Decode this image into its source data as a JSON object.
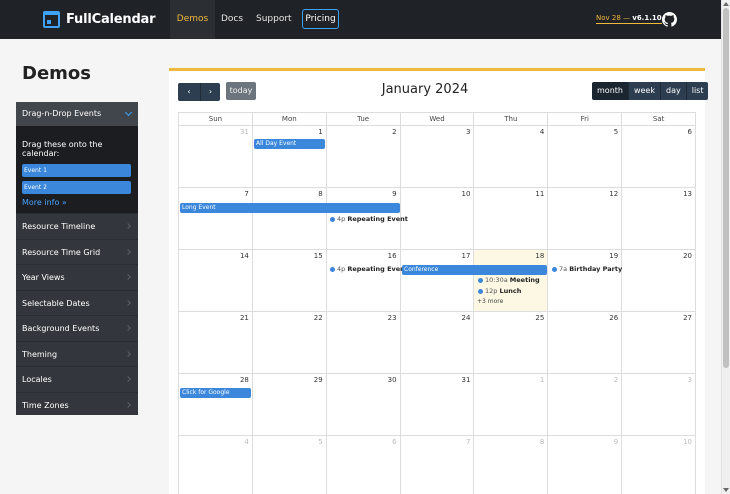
{
  "nav": {
    "logo": "FullCalendar",
    "items": [
      "Demos",
      "Docs",
      "Support"
    ],
    "pricing": "Pricing",
    "version_date": "Nov 28",
    "version_sep": " — ",
    "version_num": "v6.1.10"
  },
  "sidebar": {
    "title": "Demos",
    "active_item": "Drag-n-Drop Events",
    "drag_title": "Drag these onto the calendar:",
    "drag_events": [
      "Event 1",
      "Event 2"
    ],
    "more_info": "More info »",
    "items": [
      "Resource Timeline",
      "Resource Time Grid",
      "Year Views",
      "Selectable Dates",
      "Background Events",
      "Theming",
      "Locales",
      "Time Zones"
    ]
  },
  "toolbar": {
    "prev_icon": "‹",
    "next_icon": "›",
    "today": "today",
    "title": "January 2024",
    "views": [
      "month",
      "week",
      "day",
      "list"
    ]
  },
  "days_of_week": [
    "Sun",
    "Mon",
    "Tue",
    "Wed",
    "Thu",
    "Fri",
    "Sat"
  ],
  "weeks": [
    [
      31,
      1,
      2,
      3,
      4,
      5,
      6
    ],
    [
      7,
      8,
      9,
      10,
      11,
      12,
      13
    ],
    [
      14,
      15,
      16,
      17,
      18,
      19,
      20
    ],
    [
      21,
      22,
      23,
      24,
      25,
      26,
      27
    ],
    [
      28,
      29,
      30,
      31,
      1,
      2,
      3
    ],
    [
      4,
      5,
      6,
      7,
      8,
      9,
      10
    ]
  ],
  "events": {
    "all_day": "All Day Event",
    "long": "Long Event",
    "repeat1_time": "4p",
    "repeat1_title": "Repeating Event",
    "repeat2_time": "4p",
    "repeat2_title": "Repeating Event",
    "conference": "Conference",
    "meeting_time": "10:30a",
    "meeting_title": "Meeting",
    "lunch_time": "12p",
    "lunch_title": "Lunch",
    "more": "+3 more",
    "birthday_time": "7a",
    "birthday_title": "Birthday Party",
    "google": "Click for Google"
  },
  "colors": {
    "event": "#3a87db",
    "today_bg": "#fcf8e3",
    "accent": "#f0b83c",
    "nav_bg": "#1f2226"
  }
}
